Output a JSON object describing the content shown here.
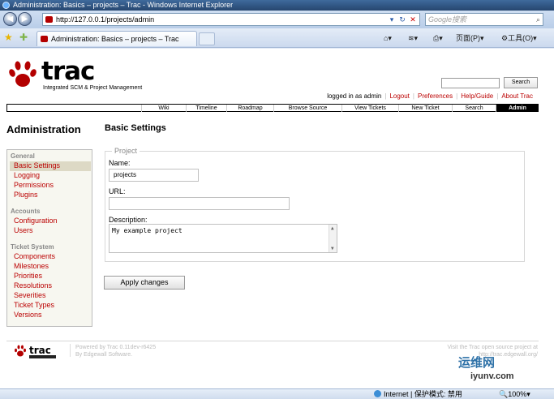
{
  "window": {
    "title": "Administration: Basics – projects – Trac - Windows Internet Explorer"
  },
  "browser": {
    "address": "http://127.0.0.1/projects/admin",
    "search_placeholder": "Google搜索",
    "tab_title": "Administration: Basics – projects – Trac",
    "page_menu": "页面(P)",
    "tools_menu": "工具(O)"
  },
  "trac": {
    "logo_text": "trac",
    "logo_subtitle": "Integrated SCM & Project Management",
    "search_button": "Search",
    "metanav": {
      "logged_in": "logged in as admin",
      "logout": "Logout",
      "preferences": "Preferences",
      "help": "Help/Guide",
      "about": "About Trac"
    },
    "mainnav": [
      "Wiki",
      "Timeline",
      "Roadmap",
      "Browse Source",
      "View Tickets",
      "New Ticket",
      "Search",
      "Admin"
    ]
  },
  "sidebar": {
    "heading": "Administration",
    "sections": [
      {
        "title": "General",
        "items": [
          "Basic Settings",
          "Logging",
          "Permissions",
          "Plugins"
        ]
      },
      {
        "title": "Accounts",
        "items": [
          "Configuration",
          "Users"
        ]
      },
      {
        "title": "Ticket System",
        "items": [
          "Components",
          "Milestones",
          "Priorities",
          "Resolutions",
          "Severities",
          "Ticket Types",
          "Versions"
        ]
      }
    ],
    "selected": "Basic Settings"
  },
  "main": {
    "heading": "Basic Settings",
    "fieldset_legend": "Project",
    "name_label": "Name:",
    "name_value": "projects",
    "url_label": "URL:",
    "url_value": "",
    "description_label": "Description:",
    "description_value": "My example project",
    "apply_button": "Apply changes"
  },
  "footer": {
    "powered_line1": "Powered by Trac 0.11dev-r6425",
    "powered_line2": "By Edgewall Software.",
    "visit_line1": "Visit the Trac open source project at",
    "visit_line2": "http://trac.edgewall.org/"
  },
  "statusbar": {
    "zone": "Internet | 保护模式: 禁用",
    "zoom": "100%"
  },
  "watermark": {
    "main": "运维网",
    "sub": "iyunv.com"
  }
}
